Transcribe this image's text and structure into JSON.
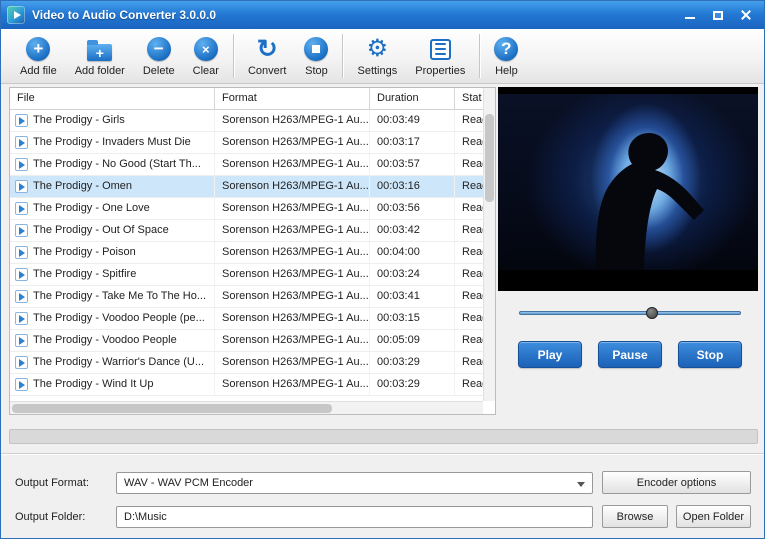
{
  "window": {
    "title": "Video to Audio Converter 3.0.0.0"
  },
  "toolbar": {
    "items": [
      {
        "label": "Add file",
        "glyph": "+"
      },
      {
        "label": "Add folder",
        "glyph": "+"
      },
      {
        "label": "Delete",
        "glyph": "−"
      },
      {
        "label": "Clear",
        "glyph": "×"
      },
      {
        "label": "Convert",
        "glyph": "↻"
      },
      {
        "label": "Stop",
        "glyph": ""
      },
      {
        "label": "Settings",
        "glyph": "⚙"
      },
      {
        "label": "Properties",
        "glyph": ""
      },
      {
        "label": "Help",
        "glyph": "?"
      }
    ]
  },
  "file_table": {
    "columns": [
      "File",
      "Format",
      "Duration",
      "Stat"
    ],
    "selected_index": 3,
    "rows": [
      {
        "file": "The Prodigy - Girls",
        "format": "Sorenson H263/MPEG-1 Au...",
        "duration": "00:03:49",
        "status": "Read"
      },
      {
        "file": "The Prodigy - Invaders Must Die",
        "format": "Sorenson H263/MPEG-1 Au...",
        "duration": "00:03:17",
        "status": "Read"
      },
      {
        "file": "The Prodigy - No Good (Start Th...",
        "format": "Sorenson H263/MPEG-1 Au...",
        "duration": "00:03:57",
        "status": "Read"
      },
      {
        "file": "The Prodigy - Omen",
        "format": "Sorenson H263/MPEG-1 Au...",
        "duration": "00:03:16",
        "status": "Read"
      },
      {
        "file": "The Prodigy - One Love",
        "format": "Sorenson H263/MPEG-1 Au...",
        "duration": "00:03:56",
        "status": "Read"
      },
      {
        "file": "The Prodigy - Out Of Space",
        "format": "Sorenson H263/MPEG-1 Au...",
        "duration": "00:03:42",
        "status": "Read"
      },
      {
        "file": "The Prodigy - Poison",
        "format": "Sorenson H263/MPEG-1 Au...",
        "duration": "00:04:00",
        "status": "Read"
      },
      {
        "file": "The Prodigy - Spitfire",
        "format": "Sorenson H263/MPEG-1 Au...",
        "duration": "00:03:24",
        "status": "Read"
      },
      {
        "file": "The Prodigy - Take Me To The Ho...",
        "format": "Sorenson H263/MPEG-1 Au...",
        "duration": "00:03:41",
        "status": "Read"
      },
      {
        "file": "The Prodigy - Voodoo People (pe...",
        "format": "Sorenson H263/MPEG-1 Au...",
        "duration": "00:03:15",
        "status": "Read"
      },
      {
        "file": "The Prodigy - Voodoo People",
        "format": "Sorenson H263/MPEG-1 Au...",
        "duration": "00:05:09",
        "status": "Read"
      },
      {
        "file": "The Prodigy - Warrior's Dance (U...",
        "format": "Sorenson H263/MPEG-1 Au...",
        "duration": "00:03:29",
        "status": "Read"
      },
      {
        "file": "The Prodigy - Wind It Up",
        "format": "Sorenson H263/MPEG-1 Au...",
        "duration": "00:03:29",
        "status": "Read"
      }
    ]
  },
  "preview": {
    "seek_percent": 60,
    "play_label": "Play",
    "pause_label": "Pause",
    "stop_label": "Stop"
  },
  "output": {
    "format_label": "Output Format:",
    "format_value": "WAV - WAV PCM Encoder",
    "encoder_options_label": "Encoder options",
    "folder_label": "Output Folder:",
    "folder_value": "D:\\Music",
    "browse_label": "Browse",
    "open_folder_label": "Open Folder"
  },
  "colors": {
    "titlebar_blue": "#2379d4",
    "accent_blue": "#1b6fc4",
    "selected_row": "#cde6f9"
  }
}
